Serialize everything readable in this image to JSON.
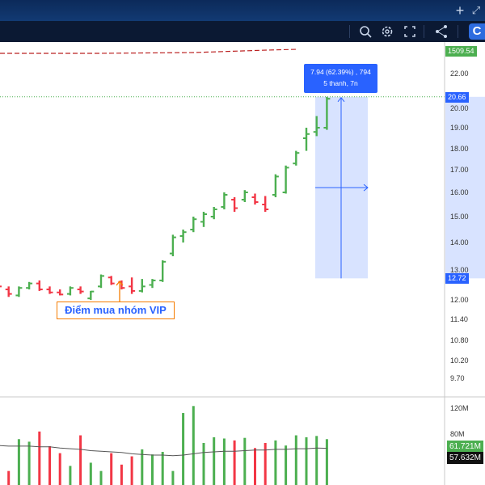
{
  "toolbar": {
    "icons": [
      "plus-icon",
      "expand-icon",
      "search-zoom-icon",
      "gear-icon",
      "fullscreen-icon",
      "share-icon",
      "app-logo"
    ]
  },
  "indicator": {
    "value": "1509.54",
    "color": "#4caf50"
  },
  "measure": {
    "line1": "7.94 (62.39%) , 794",
    "line2": "5 thanh, 7n",
    "from": 12.72,
    "to": 20.66,
    "from_label": "12.72",
    "to_label": "20.66"
  },
  "annotation": {
    "text": "Điểm mua nhóm VIP"
  },
  "volume": {
    "volume_label": "61.721M",
    "ma_label": "57.632M"
  },
  "colors": {
    "up": "#4caf50",
    "down": "#f23645",
    "measure": "#2962ff",
    "annotation": "#f57c00"
  },
  "chart_data": {
    "type": "bar",
    "price_axis": {
      "ticks": [
        "22.00",
        "20.00",
        "19.00",
        "18.00",
        "17.00",
        "16.00",
        "15.00",
        "14.00",
        "13.00",
        "12.00",
        "11.40",
        "10.80",
        "10.20",
        "9.70"
      ]
    },
    "volume_axis": {
      "ticks": [
        "120M",
        "80M"
      ]
    },
    "price_bars": [
      {
        "o": 12.55,
        "h": 12.65,
        "l": 12.4,
        "c": 12.45
      },
      {
        "o": 12.35,
        "h": 12.45,
        "l": 12.1,
        "c": 12.2
      },
      {
        "o": 12.15,
        "h": 12.45,
        "l": 12.1,
        "c": 12.4
      },
      {
        "o": 12.4,
        "h": 12.6,
        "l": 12.35,
        "c": 12.55
      },
      {
        "o": 12.55,
        "h": 12.65,
        "l": 12.3,
        "c": 12.35
      },
      {
        "o": 12.35,
        "h": 12.45,
        "l": 12.2,
        "c": 12.25
      },
      {
        "o": 12.25,
        "h": 12.35,
        "l": 12.15,
        "c": 12.18
      },
      {
        "o": 12.2,
        "h": 12.45,
        "l": 12.15,
        "c": 12.4
      },
      {
        "o": 12.35,
        "h": 12.45,
        "l": 12.2,
        "c": 12.28
      },
      {
        "o": 12.05,
        "h": 12.3,
        "l": 12.0,
        "c": 12.28
      },
      {
        "o": 12.45,
        "h": 12.85,
        "l": 12.4,
        "c": 12.8
      },
      {
        "o": 12.75,
        "h": 12.8,
        "l": 12.5,
        "c": 12.55
      },
      {
        "o": 12.6,
        "h": 12.65,
        "l": 12.35,
        "c": 12.4
      },
      {
        "o": 12.45,
        "h": 12.75,
        "l": 12.2,
        "c": 12.3
      },
      {
        "o": 12.3,
        "h": 12.7,
        "l": 12.25,
        "c": 12.45
      },
      {
        "o": 12.5,
        "h": 12.7,
        "l": 12.4,
        "c": 12.65
      },
      {
        "o": 12.65,
        "h": 13.35,
        "l": 12.6,
        "c": 13.3
      },
      {
        "o": 13.6,
        "h": 14.3,
        "l": 13.5,
        "c": 14.2
      },
      {
        "o": 14.25,
        "h": 14.5,
        "l": 14.0,
        "c": 14.4
      },
      {
        "o": 14.5,
        "h": 15.0,
        "l": 14.4,
        "c": 14.9
      },
      {
        "o": 14.8,
        "h": 15.2,
        "l": 14.6,
        "c": 15.1
      },
      {
        "o": 15.0,
        "h": 15.4,
        "l": 14.9,
        "c": 15.3
      },
      {
        "o": 15.4,
        "h": 16.0,
        "l": 15.3,
        "c": 15.9
      },
      {
        "o": 15.7,
        "h": 15.8,
        "l": 15.2,
        "c": 15.35
      },
      {
        "o": 15.7,
        "h": 16.1,
        "l": 15.6,
        "c": 16.0
      },
      {
        "o": 15.8,
        "h": 15.95,
        "l": 15.5,
        "c": 15.6
      },
      {
        "o": 15.5,
        "h": 15.85,
        "l": 15.2,
        "c": 15.3
      },
      {
        "o": 15.9,
        "h": 16.8,
        "l": 15.8,
        "c": 16.7
      },
      {
        "o": 16.0,
        "h": 17.2,
        "l": 15.95,
        "c": 17.1
      },
      {
        "o": 17.3,
        "h": 17.9,
        "l": 17.2,
        "c": 17.8
      },
      {
        "o": 18.5,
        "h": 19.0,
        "l": 17.9,
        "c": 18.7
      },
      {
        "o": 18.8,
        "h": 19.6,
        "l": 18.6,
        "c": 19.0
      },
      {
        "o": 19.0,
        "h": 20.66,
        "l": 18.9,
        "c": 20.55
      }
    ],
    "volume_values": [
      88,
      22,
      72,
      68,
      84,
      61,
      50,
      30,
      78,
      35,
      22,
      50,
      32,
      45,
      56,
      48,
      52,
      22,
      113,
      124,
      66,
      75,
      73,
      70,
      74,
      58,
      66,
      70,
      62,
      78,
      75,
      77,
      72
    ],
    "volume_ma": [
      62,
      61,
      61,
      61,
      60,
      60,
      58,
      57,
      56,
      54,
      53,
      52,
      51,
      49,
      48,
      47,
      47,
      46,
      47,
      49,
      51,
      52,
      53,
      53,
      54,
      55,
      55,
      56,
      56,
      57,
      57,
      58,
      57.6
    ]
  }
}
